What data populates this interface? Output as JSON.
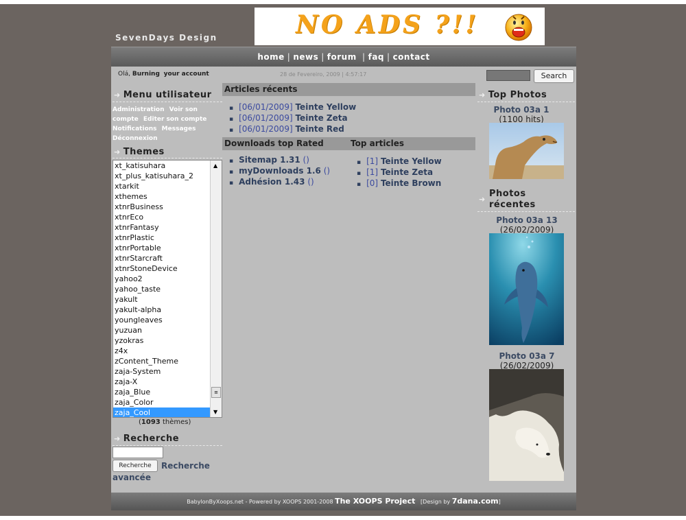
{
  "site": {
    "logo": "SevenDays Design"
  },
  "banner": {
    "text": "NO ADS ?!!"
  },
  "nav": {
    "items": [
      "home",
      "news",
      "forum",
      "faq",
      "contact"
    ]
  },
  "topbar": {
    "greeting": "Olá,",
    "username": "Burning",
    "account": "your account",
    "date": "28 de Fevereiro, 2009 | 4:57:17",
    "search_button": "Search"
  },
  "left": {
    "menu_title": "Menu utilisateur",
    "menu_items": [
      "Administration",
      "Voir son compte",
      "Editer son compte",
      "Notifications",
      "Messages",
      "Déconnexion"
    ],
    "themes_title": "Themes",
    "themes": [
      "xt_katisuhara",
      "xt_plus_katisuhara_2",
      "xtarkit",
      "xthemes",
      "xtnrBusiness",
      "xtnrEco",
      "xtnrFantasy",
      "xtnrPlastic",
      "xtnrPortable",
      "xtnrStarcraft",
      "xtnrStoneDevice",
      "yahoo2",
      "yahoo_taste",
      "yakult",
      "yakult-alpha",
      "youngleaves",
      "yuzuan",
      "yzokras",
      "z4x",
      "zContent_Theme",
      "zaja-System",
      "zaja-X",
      "zaja_Blue",
      "zaja_Color",
      "zaja_Cool"
    ],
    "selected_theme": "zaja_Cool",
    "theme_count_open": "(",
    "theme_count": "1093",
    "theme_count_label": "thèmes)",
    "search_title": "Recherche",
    "search_button": "Recherche",
    "advanced_search": "Recherche avancée"
  },
  "center": {
    "recent_title": "Articles récents",
    "recent": [
      {
        "date": "[06/01/2009]",
        "title": "Teinte Yellow"
      },
      {
        "date": "[06/01/2009]",
        "title": "Teinte Zeta"
      },
      {
        "date": "[06/01/2009]",
        "title": "Teinte Red"
      }
    ],
    "downloads_title": "Downloads top Rated",
    "downloads": [
      {
        "title": "Sitemap 1.31",
        "extra": "()"
      },
      {
        "title": "myDownloads 1.6",
        "extra": "()"
      },
      {
        "title": "Adhésion 1.43",
        "extra": "()"
      }
    ],
    "top_title": "Top articles",
    "top": [
      {
        "count": "[1]",
        "title": "Teinte Yellow"
      },
      {
        "count": "[1]",
        "title": "Teinte Zeta"
      },
      {
        "count": "[0]",
        "title": "Teinte Brown"
      }
    ]
  },
  "right": {
    "top_photos_title": "Top Photos",
    "top_photo": {
      "name": "Photo 03a 1",
      "info": "(1100 hits)"
    },
    "recent_title": "Photos récentes",
    "recent_photos": [
      {
        "name": "Photo 03a 13",
        "info": "(26/02/2009)"
      },
      {
        "name": "Photo 03a 7",
        "info": "(26/02/2009)"
      }
    ]
  },
  "footer": {
    "left": "BabylonByXoops.net - Powered by XOOPS 2001-2008",
    "project": "The XOOPS Project",
    "design_prefix": "[Design by",
    "design_site": "7dana.com",
    "design_suffix": "]"
  }
}
